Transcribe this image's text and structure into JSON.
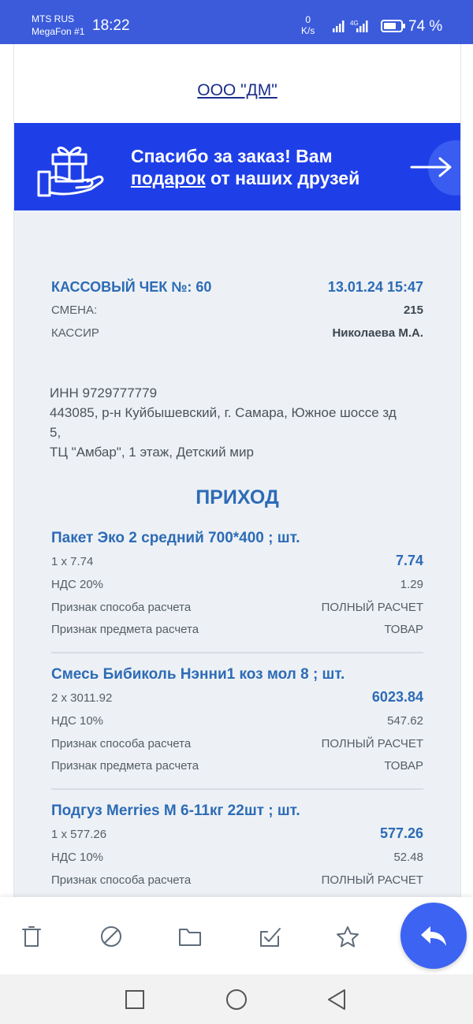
{
  "status_bar": {
    "carrier1": "MTS RUS",
    "carrier2": "MegaFon #1",
    "time": "18:22",
    "speed_value": "0",
    "speed_unit": "K/s",
    "battery_percent": "74 %"
  },
  "email": {
    "org_link": "ООО \"ДМ\"",
    "banner": {
      "line1": "Спасибо за заказ! Вам",
      "highlight": "подарок",
      "line2_rest": " от наших друзей"
    },
    "receipt": {
      "title_label": "КАССОВЫЙ ЧЕК №: 60",
      "datetime": "13.01.24 15:47",
      "shift_label": "СМЕНА:",
      "shift_value": "215",
      "cashier_label": "КАССИР",
      "cashier_value": "Николаева М.А.",
      "inn": "ИНН 9729777779",
      "address_line1": "443085, р-н Куйбышевский, г. Самара, Южное шоссе зд",
      "address_line2": "5,",
      "address_line3": "ТЦ \"Амбар\", 1 этаж, Детский мир",
      "section_title": "ПРИХОД",
      "items": [
        {
          "name": "Пакет Эко 2 средний 700*400 ; шт.",
          "qty_price": "1 x 7.74",
          "total": "7.74",
          "vat_label": "НДС 20%",
          "vat_value": "1.29",
          "method_label": "Признак способа расчета",
          "method_value": "ПОЛНЫЙ РАСЧЕТ",
          "subject_label": "Признак предмета расчета",
          "subject_value": "ТОВАР"
        },
        {
          "name": "Смесь Бибиколь Нэнни1 коз мол 8 ; шт.",
          "qty_price": "2 x 3011.92",
          "total": "6023.84",
          "vat_label": "НДС 10%",
          "vat_value": "547.62",
          "method_label": "Признак способа расчета",
          "method_value": "ПОЛНЫЙ РАСЧЕТ",
          "subject_label": "Признак предмета расчета",
          "subject_value": "ТОВАР"
        },
        {
          "name": "Подгуз Merries M 6-11кг 22шт ; шт.",
          "qty_price": "1 x 577.26",
          "total": "577.26",
          "vat_label": "НДС 10%",
          "vat_value": "52.48",
          "method_label": "Признак способа расчета",
          "method_value": "ПОЛНЫЙ РАСЧЕТ"
        }
      ]
    }
  },
  "toolbar": {
    "icons": [
      "trash-icon",
      "block-icon",
      "folder-icon",
      "mark-done-icon",
      "star-icon",
      "reply-icon"
    ]
  },
  "navbar": {
    "icons": [
      "recent-apps-icon",
      "home-icon",
      "back-icon"
    ]
  },
  "colors": {
    "status_bar": "#3b5bdb",
    "banner": "#1e3fe8",
    "accent_text": "#2d6bb6",
    "receipt_bg": "#edf1f5",
    "fab": "#3d63f2"
  }
}
